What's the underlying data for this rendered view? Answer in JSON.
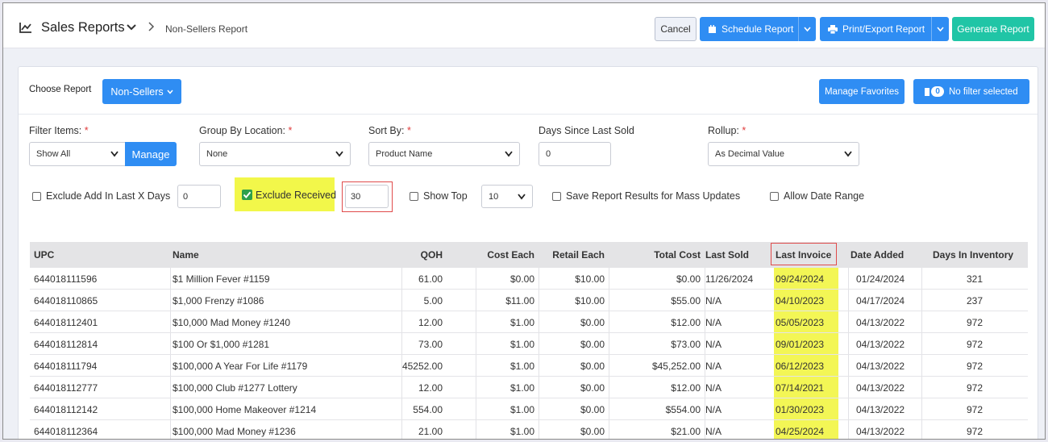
{
  "header": {
    "title": "Sales Reports",
    "breadcrumb": "Non-Sellers Report",
    "buttons": {
      "cancel": "Cancel",
      "schedule": "Schedule Report",
      "print": "Print/Export Report",
      "generate": "Generate Report"
    }
  },
  "panel": {
    "choose_label": "Choose Report",
    "report_button": "Non-Sellers",
    "favorites_button": "Manage Favorites",
    "filter_count": "0",
    "filter_label": "No filter selected"
  },
  "filters": {
    "filter_items": {
      "label": "Filter Items:",
      "value": "Show All",
      "manage": "Manage"
    },
    "group_by": {
      "label": "Group By Location:",
      "value": "None"
    },
    "sort_by": {
      "label": "Sort By:",
      "value": "Product Name"
    },
    "days_since": {
      "label": "Days Since Last Sold",
      "value": "0"
    },
    "rollup": {
      "label": "Rollup:",
      "value": "As Decimal Value"
    },
    "required_mark": "*"
  },
  "options": {
    "exclude_add": {
      "label": "Exclude Add In Last X Days",
      "value": "0",
      "checked": false
    },
    "exclude_received": {
      "label": "Exclude Received",
      "value": "30",
      "checked": true
    },
    "show_top": {
      "label": "Show Top",
      "value": "10",
      "checked": false
    },
    "save_results": {
      "label": "Save Report Results for Mass Updates",
      "checked": false
    },
    "allow_date_range": {
      "label": "Allow Date Range",
      "checked": false
    }
  },
  "colors": {
    "accent": "#2f8df3",
    "generate": "#20c5a6",
    "highlight": "#f2f74a",
    "callout": "#e04b4b"
  },
  "table": {
    "columns": [
      "UPC",
      "Name",
      "QOH",
      "Cost Each",
      "Retail Each",
      "Total Cost",
      "Last Sold",
      "Last Invoice",
      "Date Added",
      "Days In Inventory"
    ],
    "rows": [
      [
        "644018111596",
        "$1 Million Fever #1159",
        "61.00",
        "$0.00",
        "$10.00",
        "$0.00",
        "11/26/2024",
        "09/24/2024",
        "01/24/2024",
        "321"
      ],
      [
        "644018110865",
        "$1,000 Frenzy #1086",
        "5.00",
        "$11.00",
        "$10.00",
        "$55.00",
        "N/A",
        "04/10/2023",
        "04/17/2024",
        "237"
      ],
      [
        "644018112401",
        "$10,000 Mad Money #1240",
        "12.00",
        "$1.00",
        "$0.00",
        "$12.00",
        "N/A",
        "05/05/2023",
        "04/13/2022",
        "972"
      ],
      [
        "644018112814",
        "$100 Or $1,000 #1281",
        "73.00",
        "$1.00",
        "$0.00",
        "$73.00",
        "N/A",
        "09/01/2023",
        "04/13/2022",
        "972"
      ],
      [
        "644018111794",
        "$100,000 A Year For Life #1179",
        "45252.00",
        "$1.00",
        "$0.00",
        "$45,252.00",
        "N/A",
        "06/12/2023",
        "04/13/2022",
        "972"
      ],
      [
        "644018112777",
        "$100,000 Club #1277 Lottery",
        "12.00",
        "$1.00",
        "$0.00",
        "$12.00",
        "N/A",
        "07/14/2021",
        "04/13/2022",
        "972"
      ],
      [
        "644018112142",
        "$100,000 Home Makeover #1214",
        "554.00",
        "$1.00",
        "$0.00",
        "$554.00",
        "N/A",
        "01/30/2023",
        "04/13/2022",
        "972"
      ],
      [
        "644018112364",
        "$100,000 Mad Money #1236",
        "21.00",
        "$1.00",
        "$0.00",
        "$21.00",
        "N/A",
        "04/25/2024",
        "04/13/2022",
        "972"
      ]
    ]
  }
}
